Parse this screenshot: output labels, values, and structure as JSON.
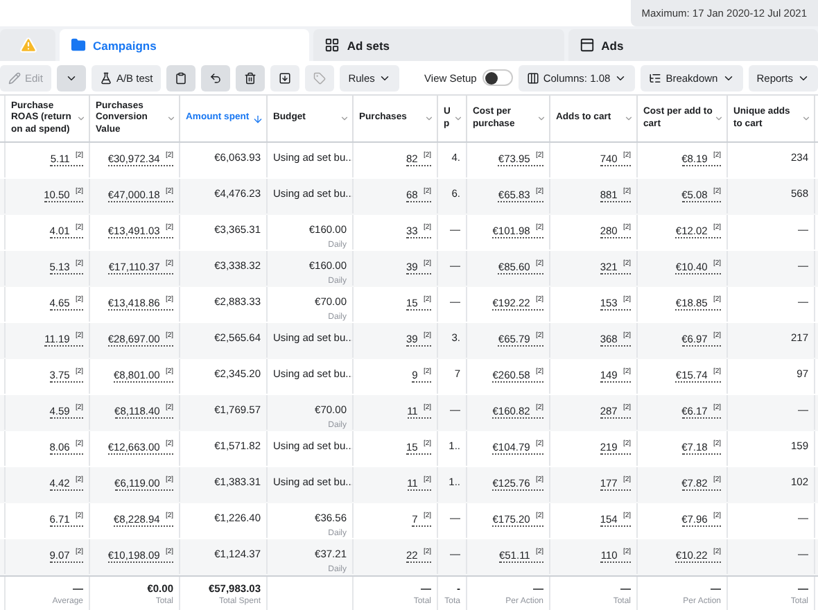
{
  "date_range": "Maximum: 17 Jan 2020-12 Jul 2021",
  "tabs": [
    {
      "kind": "warning",
      "selected": false
    },
    {
      "kind": "campaigns",
      "label": "Campaigns",
      "selected": true
    },
    {
      "kind": "adsets",
      "label": "Ad sets",
      "selected": false
    },
    {
      "kind": "ads",
      "label": "Ads",
      "selected": false
    }
  ],
  "toolbar": {
    "edit": {
      "label": "Edit",
      "disabled": true
    },
    "ab_test": "A/B test",
    "rules": "Rules",
    "view_setup": {
      "label": "View Setup",
      "on": false
    },
    "columns": "Columns: 1.08",
    "breakdown": "Breakdown",
    "reports": "Reports"
  },
  "table": {
    "columns": [
      {
        "label": "Purchase ROAS (return on ad spend)",
        "sorted": false,
        "underlined": true
      },
      {
        "label": "Purchases Conversion Value",
        "sorted": false,
        "underlined": true
      },
      {
        "label": "Amount spent",
        "sorted": true,
        "underlined": false
      },
      {
        "label": "Budget",
        "sorted": false,
        "underlined": false
      },
      {
        "label": "Purchases",
        "sorted": false,
        "underlined": true
      },
      {
        "label": "U p",
        "sorted": false,
        "underlined": false
      },
      {
        "label": "Cost per purchase",
        "sorted": false,
        "underlined": true
      },
      {
        "label": "Adds to cart",
        "sorted": false,
        "underlined": true
      },
      {
        "label": "Cost per add to cart",
        "sorted": false,
        "underlined": true
      },
      {
        "label": "Unique adds to cart",
        "sorted": false,
        "underlined": false
      }
    ],
    "rows": [
      {
        "cells": [
          "5.11 $^{[2]}$",
          "€30,972.34 $^{[2]}$",
          "€6,063.93",
          {
            "value": "Using ad set bu..."
          },
          "82 $^{[2]}$",
          "4.",
          "€73.95 $^{[2]}$",
          "740 $^{[2]}$",
          "€8.19 $^{[2]}$",
          "234"
        ]
      },
      {
        "cells": [
          "10.50 $^{[2]}$",
          "€47,000.18 $^{[2]}$",
          "€4,476.23",
          {
            "value": "Using ad set bu..."
          },
          "68 $^{[2]}$",
          "6.",
          "€65.83 $^{[2]}$",
          "881 $^{[2]}$",
          "€5.08 $^{[2]}$",
          "568"
        ]
      },
      {
        "cells": [
          "4.01 $^{[2]}$",
          "€13,491.03 $^{[2]}$",
          "€3,365.31",
          {
            "value": "€160.00",
            "period": "Daily"
          },
          "33 $^{[2]}$",
          "—",
          "€101.98 $^{[2]}$",
          "280 $^{[2]}$",
          "€12.02 $^{[2]}$",
          "—"
        ]
      },
      {
        "cells": [
          "5.13 $^{[2]}$",
          "€17,110.37 $^{[2]}$",
          "€3,338.32",
          {
            "value": "€160.00",
            "period": "Daily"
          },
          "39 $^{[2]}$",
          "—",
          "€85.60 $^{[2]}$",
          "321 $^{[2]}$",
          "€10.40 $^{[2]}$",
          "—"
        ]
      },
      {
        "cells": [
          "4.65 $^{[2]}$",
          "€13,418.86 $^{[2]}$",
          "€2,883.33",
          {
            "value": "€70.00",
            "period": "Daily"
          },
          "15 $^{[2]}$",
          "—",
          "€192.22 $^{[2]}$",
          "153 $^{[2]}$",
          "€18.85 $^{[2]}$",
          "—"
        ]
      },
      {
        "cells": [
          "11.19 $^{[2]}$",
          "€28,697.00 $^{[2]}$",
          "€2,565.64",
          {
            "value": "Using ad set bu..."
          },
          "39 $^{[2]}$",
          "3.",
          "€65.79 $^{[2]}$",
          "368 $^{[2]}$",
          "€6.97 $^{[2]}$",
          "217"
        ]
      },
      {
        "cells": [
          "3.75 $^{[2]}$",
          "€8,801.00 $^{[2]}$",
          "€2,345.20",
          {
            "value": "Using ad set bu..."
          },
          "9 $^{[2]}$",
          "7",
          "€260.58 $^{[2]}$",
          "149 $^{[2]}$",
          "€15.74 $^{[2]}$",
          "97"
        ]
      },
      {
        "cells": [
          "4.59 $^{[2]}$",
          "€8,118.40 $^{[2]}$",
          "€1,769.57",
          {
            "value": "€70.00",
            "period": "Daily"
          },
          "11 $^{[2]}$",
          "—",
          "€160.82 $^{[2]}$",
          "287 $^{[2]}$",
          "€6.17 $^{[2]}$",
          "—"
        ]
      },
      {
        "cells": [
          "8.06 $^{[2]}$",
          "€12,663.00 $^{[2]}$",
          "€1,571.82",
          {
            "value": "Using ad set bu..."
          },
          "15 $^{[2]}$",
          "1..",
          "€104.79 $^{[2]}$",
          "219 $^{[2]}$",
          "€7.18 $^{[2]}$",
          "159"
        ]
      },
      {
        "cells": [
          "4.42 $^{[2]}$",
          "€6,119.00 $^{[2]}$",
          "€1,383.31",
          {
            "value": "Using ad set bu..."
          },
          "11 $^{[2]}$",
          "1..",
          "€125.76 $^{[2]}$",
          "177 $^{[2]}$",
          "€7.82 $^{[2]}$",
          "102"
        ]
      },
      {
        "cells": [
          "6.71 $^{[2]}$",
          "€8,228.94 $^{[2]}$",
          "€1,226.40",
          {
            "value": "€36.56",
            "period": "Daily"
          },
          "7 $^{[2]}$",
          "—",
          "€175.20 $^{[2]}$",
          "154 $^{[2]}$",
          "€7.96 $^{[2]}$",
          "—"
        ]
      },
      {
        "cells": [
          "9.07 $^{[2]}$",
          "€10,198.09 $^{[2]}$",
          "€1,124.37",
          {
            "value": "€37.21",
            "period": "Daily"
          },
          "22 $^{[2]}$",
          "—",
          "€51.11 $^{[2]}$",
          "110 $^{[2]}$",
          "€10.22 $^{[2]}$",
          "—"
        ]
      }
    ],
    "footer": {
      "left": [
        {
          "value": "—",
          "caption": "Average"
        },
        {
          "value": "€0.00",
          "caption": "Total"
        },
        {
          "value": "€57,983.03",
          "caption": "Total Spent"
        }
      ],
      "right": [
        {
          "value": "—",
          "caption": "Total"
        },
        {
          "value": "-",
          "caption": "Tota"
        },
        {
          "value": "—",
          "caption": "Per Action"
        },
        {
          "value": "—",
          "caption": "Total"
        },
        {
          "value": "—",
          "caption": "Per Action"
        },
        {
          "value": "—",
          "caption": "Total"
        }
      ]
    }
  }
}
